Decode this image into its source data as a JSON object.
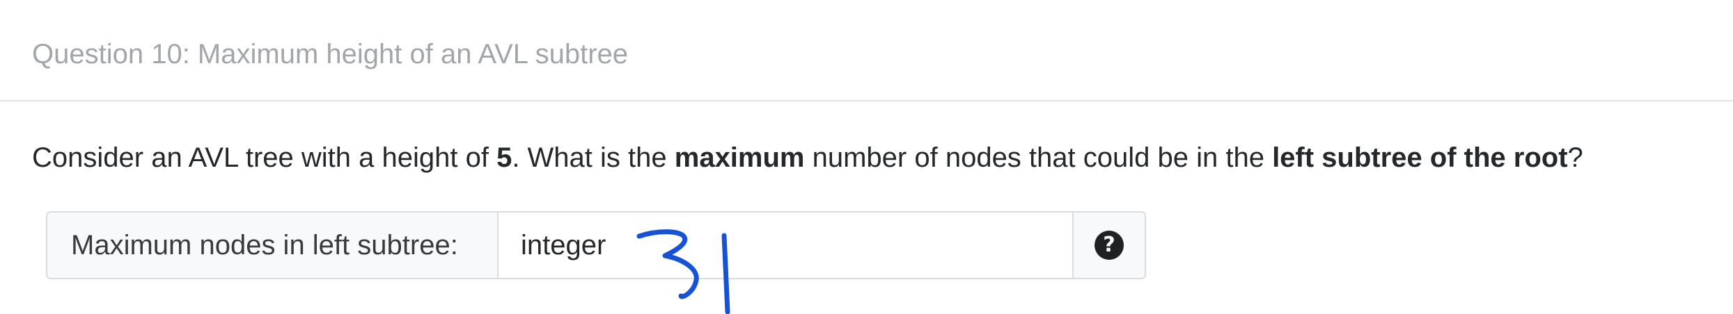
{
  "question": {
    "title": "Question 10: Maximum height of an AVL subtree",
    "prompt_parts": {
      "p1": "Consider an AVL tree with a height of ",
      "b1": "5",
      "p2": ". What is the ",
      "b2": "maximum",
      "p3": " number of nodes that could be in the ",
      "b3": "left subtree of the root",
      "p4": "?"
    }
  },
  "answer": {
    "label": "Maximum nodes in left subtree:",
    "placeholder": "integer",
    "value": "",
    "help_icon": "question-circle-icon",
    "help_glyph": "?"
  },
  "annotation": {
    "handwritten_text": "31",
    "ink_color": "#1652d6"
  },
  "colors": {
    "title": "#a2a6ab",
    "text": "#25282b",
    "border": "#d8dbdf"
  }
}
